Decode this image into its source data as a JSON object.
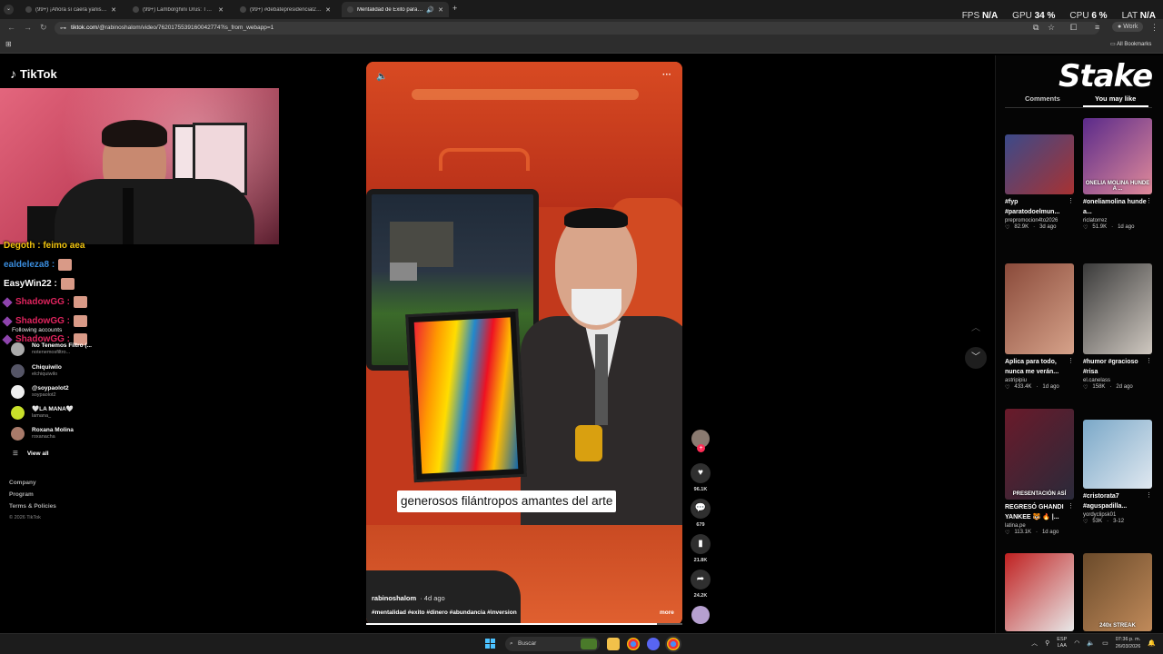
{
  "browser": {
    "tabs": [
      {
        "label": "(99+) ¡Ahora sí caerá yanis? #EI"
      },
      {
        "label": "(99+) Lamborghini Urus: The S"
      },
      {
        "label": "(99+) #debatepresidencial2026"
      },
      {
        "label": "Mentalidad de Éxito para la"
      }
    ],
    "url_host": "tiktok.com",
    "url_path": "/@rabinoshalom/video/7620175539160042774?is_from_webapp=1",
    "profile_label": "Work",
    "all_bookmarks": "All Bookmarks"
  },
  "overlay_stats": {
    "fps_label": "FPS",
    "fps_value": "N/A",
    "gpu_label": "GPU",
    "gpu_value": "34",
    "cpu_label": "CPU",
    "cpu_value": "6",
    "lat_label": "LAT",
    "lat_value": "N/A"
  },
  "tiktok": {
    "logo": "TikTok",
    "chat": [
      {
        "user": "Degoth : feimo aea",
        "color": "#f1c40f",
        "badge": false,
        "emote": false
      },
      {
        "user": "ealdeleza8 :",
        "color": "#3a8dde",
        "badge": false,
        "emote": true
      },
      {
        "user": "EasyWin22 :",
        "color": "#ffffff",
        "badge": false,
        "emote": true
      },
      {
        "user": "ShadowGG :",
        "color": "#e0245e",
        "badge": true,
        "emote": true
      },
      {
        "user": "ShadowGG :",
        "color": "#e0245e",
        "badge": true,
        "emote": true
      },
      {
        "user": "ShadowGG :",
        "color": "#e0245e",
        "badge": true,
        "emote": true
      }
    ],
    "following_title": "Following accounts",
    "following": [
      {
        "name": "No Tenemos Filtro (...",
        "handle": "notenemosfiltro..."
      },
      {
        "name": "Chiquiwilo",
        "handle": "elchiquiwilo"
      },
      {
        "name": "@soypaolot2",
        "handle": "soypaolot2"
      },
      {
        "name": "🤍LA MANA🤍",
        "handle": "lamana_"
      },
      {
        "name": "Roxana Molina",
        "handle": "roxanacha"
      }
    ],
    "view_all": "View all",
    "footer": [
      "Company",
      "Program",
      "Terms & Policies"
    ],
    "copyright": "© 2026 TikTok"
  },
  "video": {
    "caption": "generosos filántropos amantes del arte",
    "author": "rabinoshalom",
    "ago": "· 4d ago",
    "tags": "#mentalidad #exito #dinero #abundancia #inversion",
    "more": "more",
    "progress": 0.92,
    "actions": {
      "likes": "96.1K",
      "comments": "679",
      "saves": "21.8K",
      "shares": "24.2K"
    }
  },
  "right_panel": {
    "overlay_logo": "Stake",
    "tab_comments": "Comments",
    "tab_you_may_like": "You may like",
    "cards": [
      {
        "title": "#fyp #paratodoelmun...",
        "author": "prepromocion4to2026",
        "likes": "82.9K",
        "ago": "3d ago",
        "thumb_text": "",
        "c1": "#3b4a8a",
        "c2": "#a83232"
      },
      {
        "title": "#oneliamolina hunde a...",
        "author": "riclatorrez",
        "likes": "51.9K",
        "ago": "1d ago",
        "thumb_text": "ONELIA MOLINA HUNDE A ...",
        "c1": "#5a2a8a",
        "c2": "#e08a9a"
      },
      {
        "title": "Aplica para todo, nunca me verán...",
        "author": "astripipiu",
        "likes": "433.4K",
        "ago": "1d ago",
        "thumb_text": "",
        "c1": "#8a4a3a",
        "c2": "#d6a28a"
      },
      {
        "title": "#humor #gracioso #risa",
        "author": "el.canelass",
        "likes": "158K",
        "ago": "2d ago",
        "thumb_text": "",
        "c1": "#3a3a3a",
        "c2": "#cfc8c0"
      },
      {
        "title": "REGRESÓ GHANDI YANKEE 🐯 🔥 |...",
        "author": "latina.pe",
        "likes": "113.1K",
        "ago": "1d ago",
        "thumb_text": "PRESENTACIÓN ASÍ",
        "c1": "#6a1a2a",
        "c2": "#2a2a3a"
      },
      {
        "title": "#cristorata7 #aguspadilla...",
        "author": "yordyclipsk01",
        "likes": "53K",
        "ago": "3-12",
        "thumb_text": "",
        "c1": "#7aa8c8",
        "c2": "#e0e8f0"
      },
      {
        "title": "",
        "author": "",
        "likes": "",
        "ago": "",
        "thumb_text": "",
        "c1": "#c02020",
        "c2": "#e8e8e8"
      },
      {
        "title": "",
        "author": "",
        "likes": "",
        "ago": "",
        "thumb_text": "240x STREAK",
        "c1": "#6a4a2a",
        "c2": "#c08a5a"
      }
    ]
  },
  "taskbar": {
    "search_placeholder": "Buscar",
    "lang_top": "ESP",
    "lang_bottom": "LAA",
    "time": "07:36 p. m.",
    "date": "26/03/2026"
  },
  "colors": {
    "accent": "#fe2c55",
    "video_bg": "#c2391c"
  }
}
